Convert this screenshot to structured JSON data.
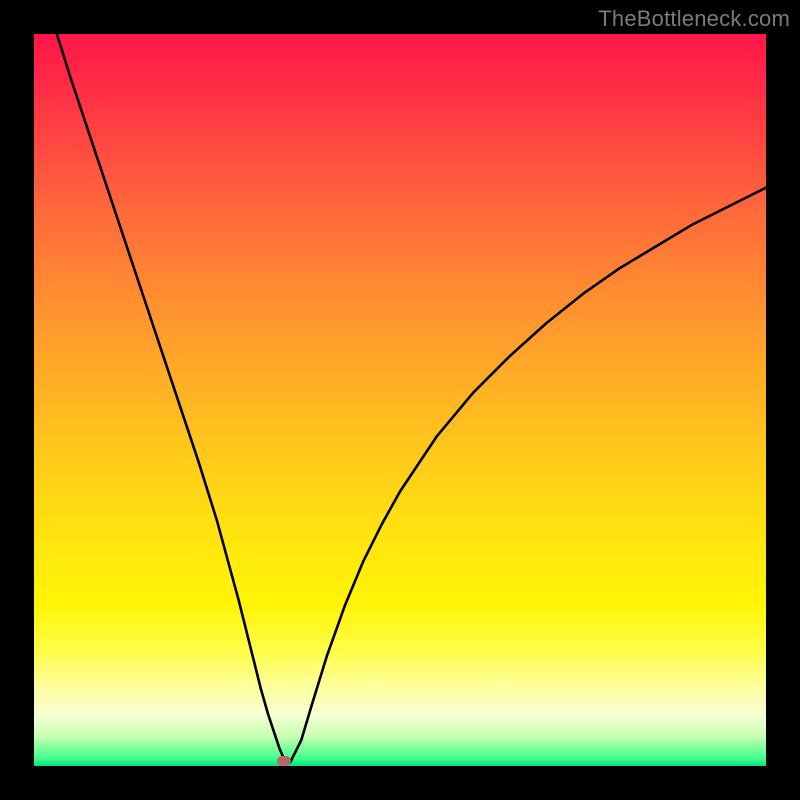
{
  "watermark": "TheBottleneck.com",
  "colors": {
    "frame": "#000000",
    "curve": "#000000",
    "marker": "#b46868"
  },
  "chart_data": {
    "type": "line",
    "title": "",
    "xlabel": "",
    "ylabel": "",
    "xlim": [
      0,
      100
    ],
    "ylim": [
      0,
      100
    ],
    "grid": false,
    "legend": false,
    "x": [
      0,
      2.5,
      5,
      7.5,
      10,
      12.5,
      15,
      17.5,
      20,
      22.5,
      25,
      26.5,
      28,
      29,
      30,
      31,
      32,
      33,
      33.5,
      34,
      34.5,
      35,
      36.5,
      38,
      40,
      42.5,
      45,
      47.5,
      50,
      55,
      60,
      65,
      70,
      75,
      80,
      85,
      90,
      95,
      100
    ],
    "y": [
      110,
      102,
      94,
      86.5,
      79,
      71.5,
      64,
      56.5,
      49,
      41.5,
      33.5,
      28,
      22.5,
      18.5,
      14.5,
      10.5,
      7,
      4,
      2.5,
      1.3,
      0.6,
      0.5,
      3.5,
      8.5,
      15,
      22,
      28,
      33,
      37.5,
      45,
      51,
      56,
      60.5,
      64.5,
      68,
      71,
      74,
      76.5,
      79
    ],
    "marker": {
      "x": 34.2,
      "y": 0.7
    },
    "gradient_stops": [
      {
        "pos": 0.0,
        "color": "#ff1648"
      },
      {
        "pos": 0.2,
        "color": "#ff5a3f"
      },
      {
        "pos": 0.44,
        "color": "#ffa528"
      },
      {
        "pos": 0.68,
        "color": "#ffe310"
      },
      {
        "pos": 0.89,
        "color": "#fdff9a"
      },
      {
        "pos": 1.0,
        "color": "#00e27a"
      }
    ]
  }
}
